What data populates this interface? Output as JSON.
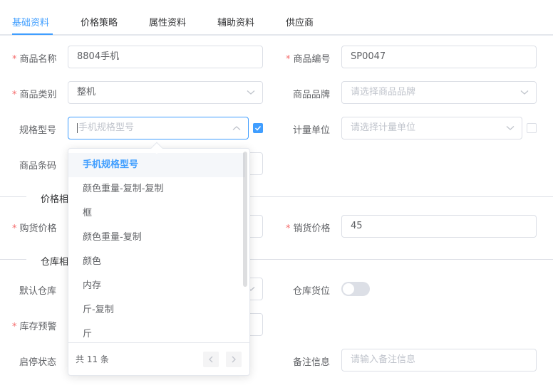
{
  "tabs": [
    "基础资料",
    "价格策略",
    "属性资料",
    "辅助资料",
    "供应商"
  ],
  "form": {
    "name_label": "商品名称",
    "name_value": "8804手机",
    "code_label": "商品编号",
    "code_value": "SP0047",
    "category_label": "商品类别",
    "category_value": "整机",
    "brand_label": "商品品牌",
    "brand_placeholder": "请选择商品品牌",
    "spec_label": "规格型号",
    "spec_placeholder": "手机规格型号",
    "unit_label": "计量单位",
    "unit_placeholder": "请选择计量单位",
    "barcode_label": "商品条码",
    "price_divider": "价格相",
    "purchase_price_label": "购货价格",
    "sale_price_label": "销货价格",
    "sale_price_value": "45",
    "warehouse_divider": "仓库相",
    "default_warehouse_label": "默认仓库",
    "warehouse_location_label": "仓库货位",
    "stock_warning_label": "库存预警",
    "status_label": "启停状态",
    "remark_label": "备注信息",
    "remark_placeholder": "请输入备注信息",
    "required_mark": "*"
  },
  "spec_checkbox_checked": true,
  "unit_checkbox_checked": false,
  "warehouse_location_switch_on": false,
  "dropdown": {
    "options": [
      "手机规格型号",
      "颜色重量-复制-复制",
      "框",
      "颜色重量-复制",
      "颜色",
      "内存",
      "斤-复制",
      "斤"
    ],
    "selected_index": 0,
    "total_text": "共 11 条"
  },
  "colors": {
    "accent": "#409eff",
    "required": "#f56c6c",
    "border": "#dcdfe6"
  },
  "icons": {
    "select": "chevron-down-icon",
    "open_select": "chevron-up-icon",
    "prev": "chevron-left-icon",
    "next": "chevron-right-icon",
    "check": "check-icon"
  }
}
